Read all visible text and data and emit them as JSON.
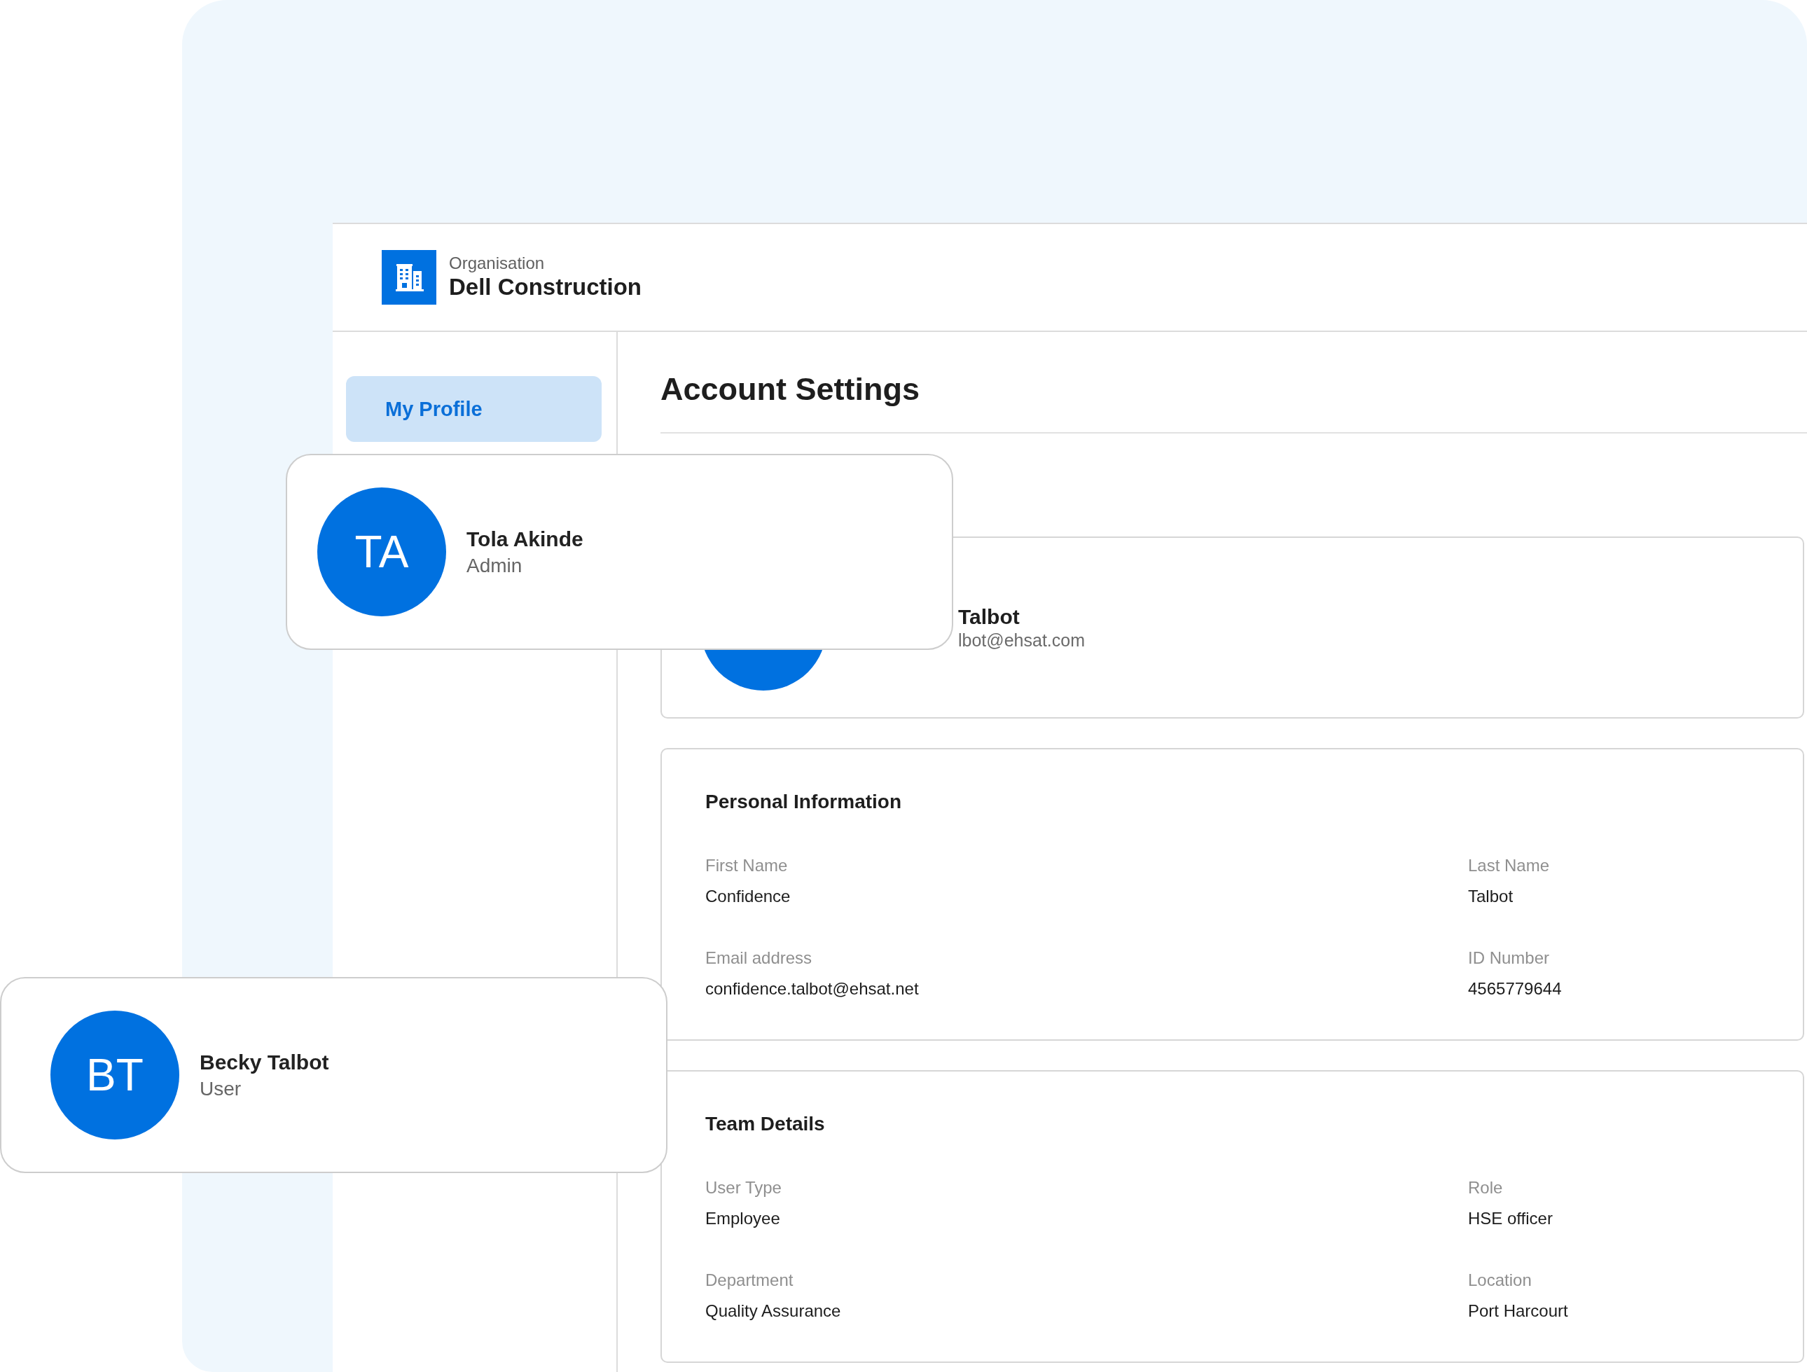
{
  "organisation": {
    "label": "Organisation",
    "name": "Dell Construction"
  },
  "sidebar": {
    "items": [
      {
        "label": "My Profile",
        "selected": true
      }
    ]
  },
  "page_title": "Account Settings",
  "profile": {
    "name": "Talbot",
    "email": "lbot@ehsat.com"
  },
  "sections": [
    {
      "title": "Personal Information",
      "fields": [
        {
          "label": "First Name",
          "value": "Confidence"
        },
        {
          "label": "Last Name",
          "value": "Talbot"
        },
        {
          "label": "Email address",
          "value": "confidence.talbot@ehsat.net"
        },
        {
          "label": "ID Number",
          "value": "4565779644"
        }
      ]
    },
    {
      "title": "Team Details",
      "fields": [
        {
          "label": "User Type",
          "value": "Employee"
        },
        {
          "label": "Role",
          "value": "HSE officer"
        },
        {
          "label": "Department",
          "value": "Quality Assurance"
        },
        {
          "label": "Location",
          "value": "Port Harcourt"
        }
      ]
    }
  ],
  "user_cards": [
    {
      "initials": "TA",
      "name": "Tola Akinde",
      "role": "Admin"
    },
    {
      "initials": "BT",
      "name": "Becky Talbot",
      "role": "User"
    }
  ]
}
